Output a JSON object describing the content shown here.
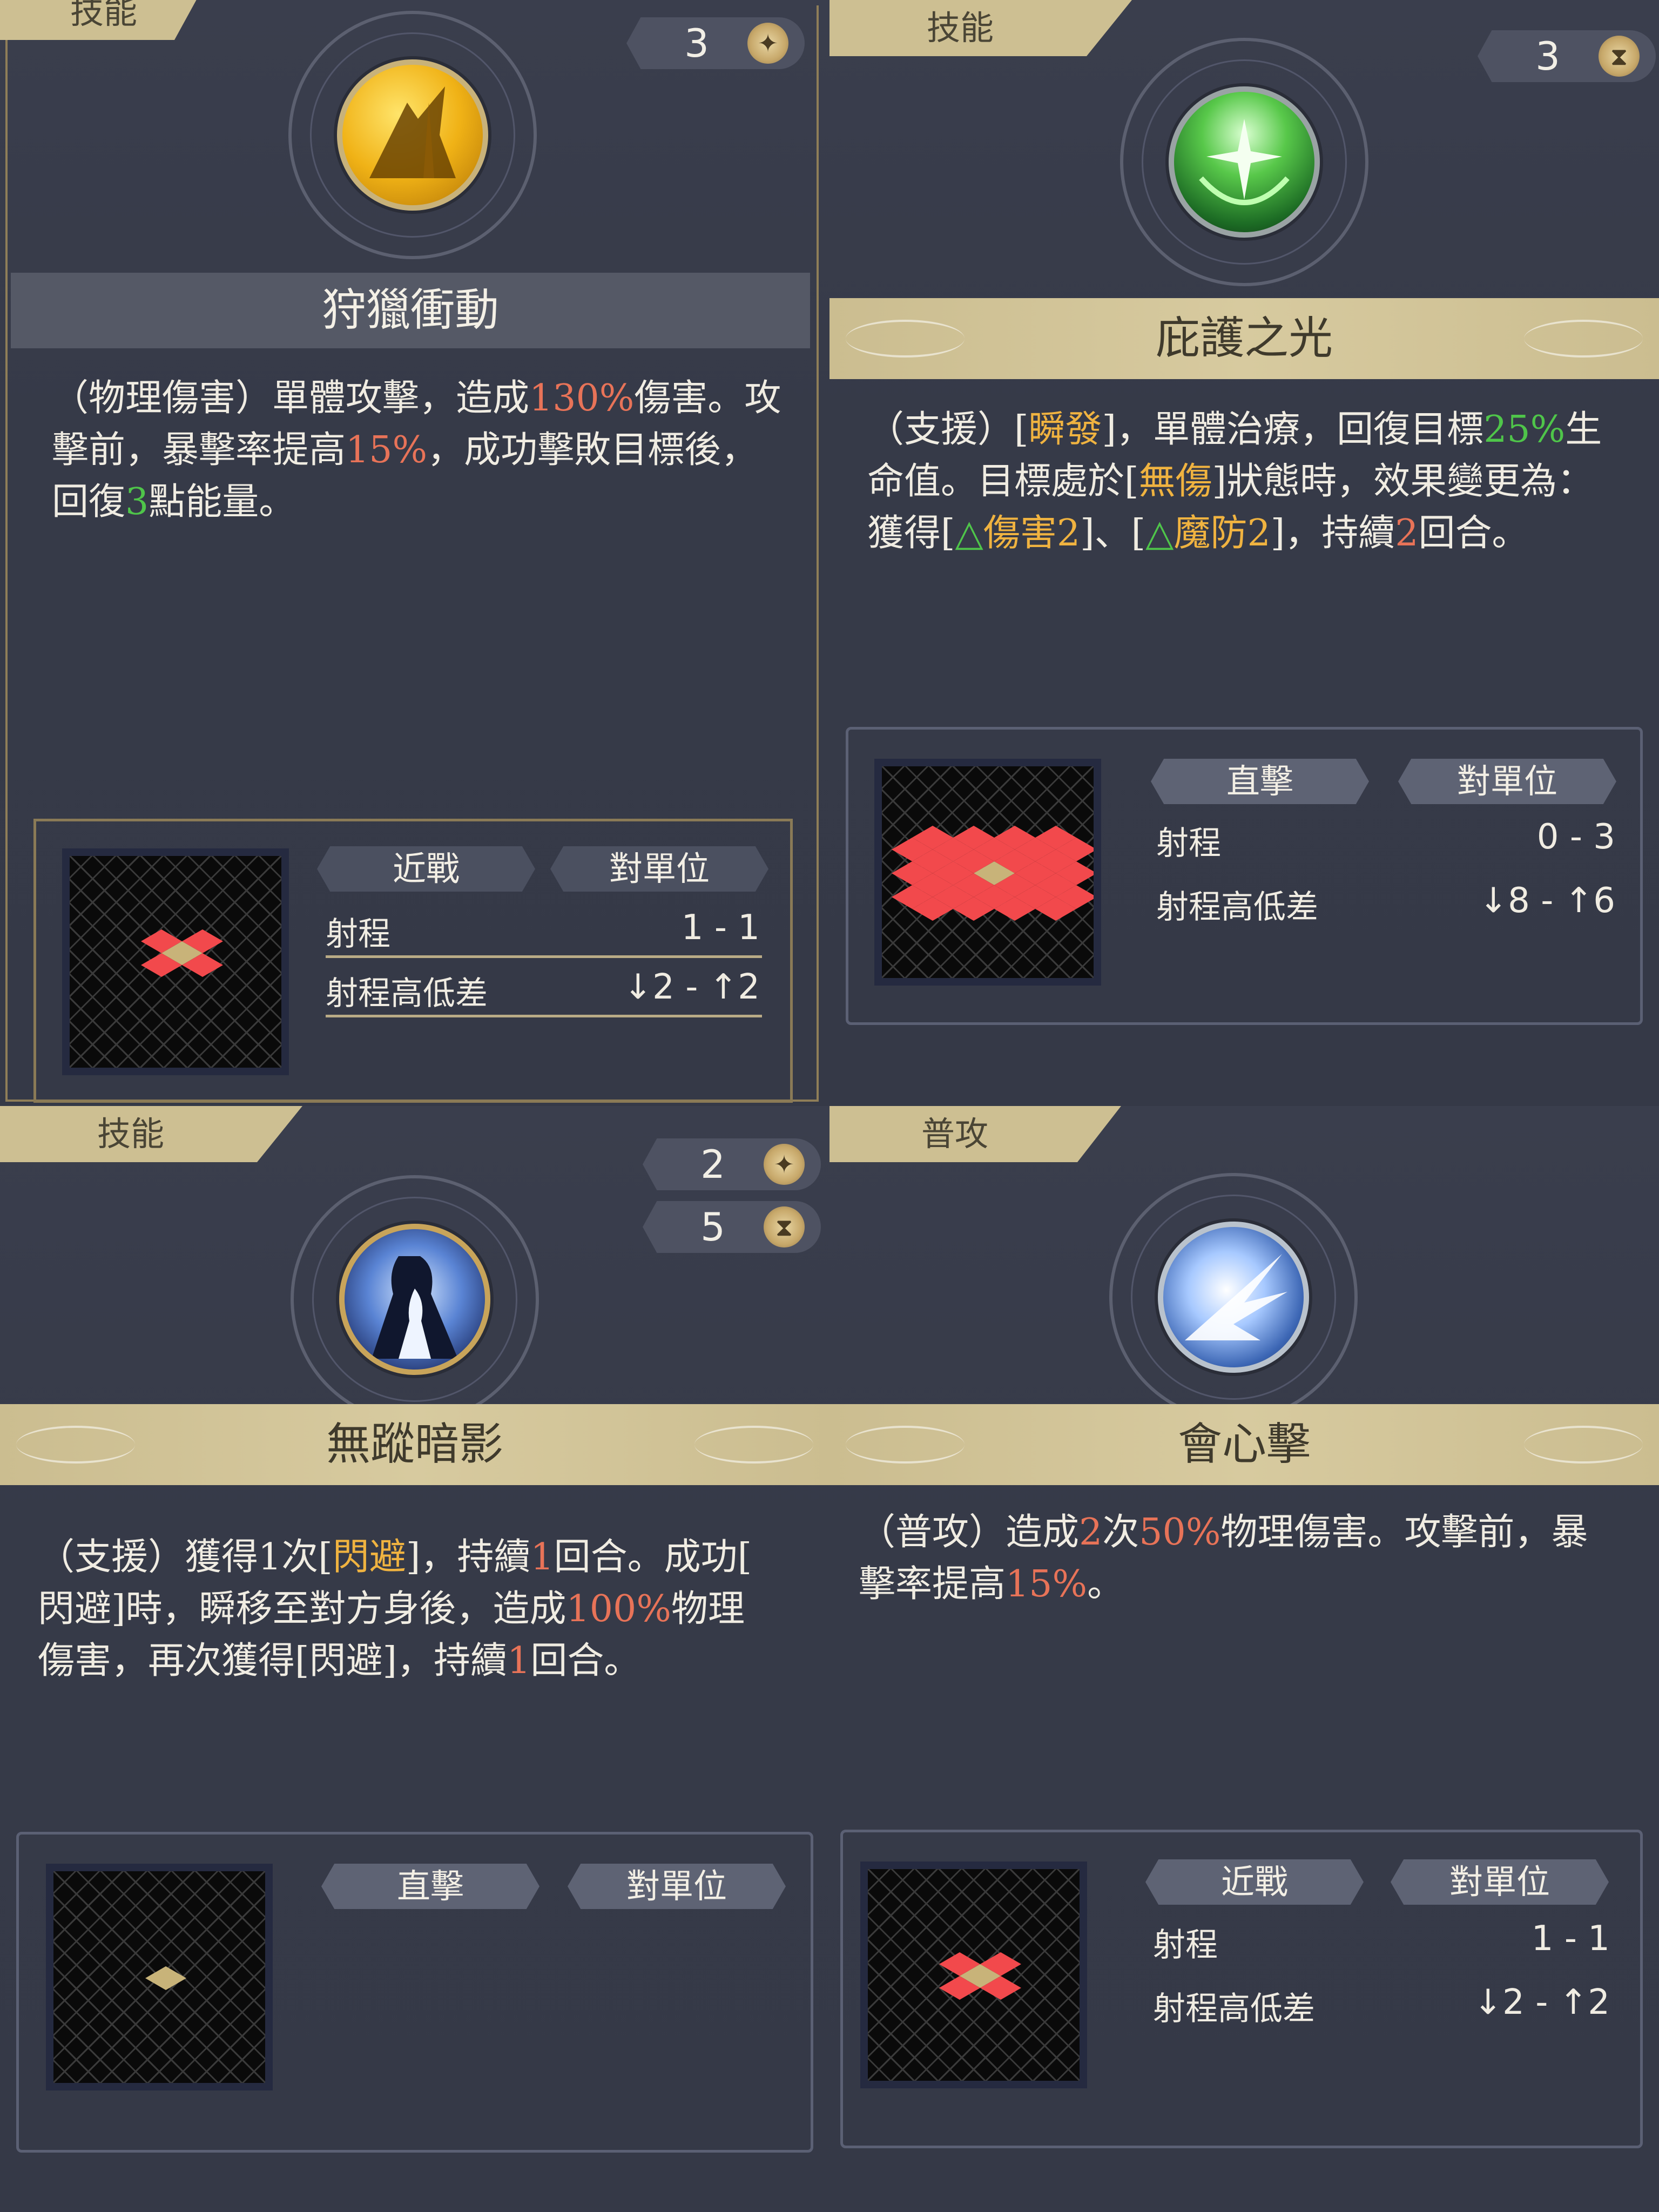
{
  "panels": [
    {
      "tag": "技能",
      "pills": [
        {
          "value": "3",
          "icon": "star-sparkle-icon"
        }
      ],
      "icon": "hunter-leap-icon",
      "title": "狩獵衝動",
      "desc": {
        "l1a": "（物理傷害）單體攻擊，造成",
        "l1b": "130%",
        "l1c": "傷害。攻",
        "l2a": "擊前，暴擊率提高",
        "l2b": "15%",
        "l2c": "，成功擊敗目標後，",
        "l3a": "回復",
        "l3b": "3",
        "l3c": "點能量。"
      },
      "chips": [
        "近戰",
        "對單位"
      ],
      "range_label": "射程",
      "range_value": "1 - 1",
      "height_label": "射程高低差",
      "height_value": "↓2 - ↑2"
    },
    {
      "tag": "技能",
      "pills": [
        {
          "value": "3",
          "icon": "hourglass-icon"
        }
      ],
      "icon": "shield-light-icon",
      "title": "庇護之光",
      "desc": {
        "l1a": "（支援）[",
        "l1b": "瞬發",
        "l1c": "]，單體治療，回復目標",
        "l1d": "25%",
        "l1e": "生",
        "l2a": "命值。目標處於[",
        "l2b": "無傷",
        "l2c": "]狀態時，效果變更為：",
        "l3a": "獲得[",
        "l3b": "△",
        "l3c": "傷害2",
        "l3d": "]、[",
        "l3e": "△",
        "l3f": "魔防2",
        "l3g": "]，持續",
        "l3h": "2",
        "l3i": "回合。"
      },
      "chips": [
        "直擊",
        "對單位"
      ],
      "range_label": "射程",
      "range_value": "0 - 3",
      "height_label": "射程高低差",
      "height_value": "↓8 - ↑6"
    },
    {
      "tag": "技能",
      "pills": [
        {
          "value": "2",
          "icon": "star-sparkle-icon"
        },
        {
          "value": "5",
          "icon": "hourglass-icon"
        }
      ],
      "icon": "shadow-assassin-icon",
      "title": "無蹤暗影",
      "desc": {
        "l1a": "（支援）獲得1次[",
        "l1b": "閃避",
        "l1c": "]，持續",
        "l1d": "1",
        "l1e": "回合。成功[",
        "l2a": "閃避]時，瞬移至對方身後，造成",
        "l2b": "100%",
        "l2c": "物理",
        "l3a": "傷害，再次獲得[閃避]，持續",
        "l3b": "1",
        "l3c": "回合。"
      },
      "chips": [
        "直擊",
        "對單位"
      ]
    },
    {
      "tag": "普攻",
      "icon": "critical-strike-icon",
      "title": "會心擊",
      "desc": {
        "l1a": "（普攻）造成",
        "l1b": "2",
        "l1c": "次",
        "l1d": "50%",
        "l1e": "物理傷害。攻擊前，暴",
        "l2a": "擊率提高",
        "l2b": "15%",
        "l2c": "。"
      },
      "chips": [
        "近戰",
        "對單位"
      ],
      "range_label": "射程",
      "range_value": "1 - 1",
      "height_label": "射程高低差",
      "height_value": "↓2 - ↑2"
    }
  ],
  "icons": {
    "star": "✦",
    "hourglass": "⧗"
  }
}
